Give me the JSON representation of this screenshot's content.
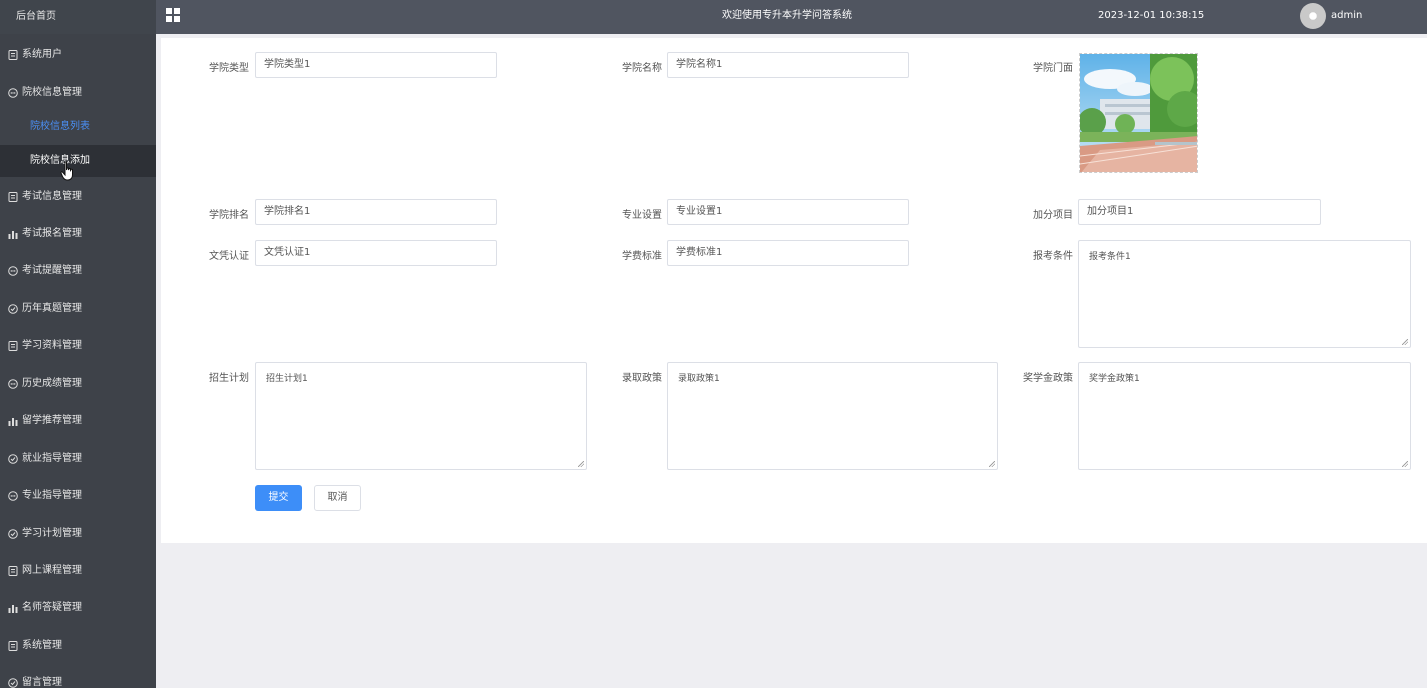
{
  "sidebar": {
    "home": "后台首页",
    "items": [
      {
        "label": "系统用户",
        "icon": "document-icon"
      },
      {
        "label": "院校信息管理",
        "icon": "chat-icon"
      },
      {
        "label": "考试信息管理",
        "icon": "document-icon"
      },
      {
        "label": "考试报名管理",
        "icon": "bar-chart-icon"
      },
      {
        "label": "考试提醒管理",
        "icon": "chat-icon"
      },
      {
        "label": "历年真题管理",
        "icon": "check-circle-icon"
      },
      {
        "label": "学习资料管理",
        "icon": "document-icon"
      },
      {
        "label": "历史成绩管理",
        "icon": "chat-icon"
      },
      {
        "label": "留学推荐管理",
        "icon": "bar-chart-icon"
      },
      {
        "label": "就业指导管理",
        "icon": "check-circle-icon"
      },
      {
        "label": "专业指导管理",
        "icon": "chat-icon"
      },
      {
        "label": "学习计划管理",
        "icon": "check-circle-icon"
      },
      {
        "label": "网上课程管理",
        "icon": "document-icon"
      },
      {
        "label": "名师答疑管理",
        "icon": "bar-chart-icon"
      },
      {
        "label": "系统管理",
        "icon": "document-icon"
      },
      {
        "label": "留言管理",
        "icon": "check-circle-icon"
      }
    ],
    "sub_items": [
      {
        "label": "院校信息列表"
      },
      {
        "label": "院校信息添加"
      }
    ]
  },
  "topbar": {
    "title": "欢迎使用专升本升学问答系统",
    "datetime": "2023-12-01 10:38:15",
    "user": "admin"
  },
  "form": {
    "labels": {
      "college_type": "学院类型",
      "college_name": "学院名称",
      "college_gate": "学院门面",
      "college_rank": "学院排名",
      "major_setting": "专业设置",
      "bonus_items": "加分项目",
      "diploma_cert": "文凭认证",
      "tuition": "学费标准",
      "requirements": "报考条件",
      "enrollment_plan": "招生计划",
      "admission_policy": "录取政策",
      "scholarship_policy": "奖学金政策"
    },
    "values": {
      "college_type": "学院类型1",
      "college_name": "学院名称1",
      "college_rank": "学院排名1",
      "major_setting": "专业设置1",
      "bonus_items": "加分项目1",
      "diploma_cert": "文凭认证1",
      "tuition": "学费标准1",
      "requirements": "报考条件1",
      "enrollment_plan": "招生计划1",
      "admission_policy": "录取政策1",
      "scholarship_policy": "奖学金政策1"
    },
    "submit_label": "提交",
    "cancel_label": "取消"
  }
}
